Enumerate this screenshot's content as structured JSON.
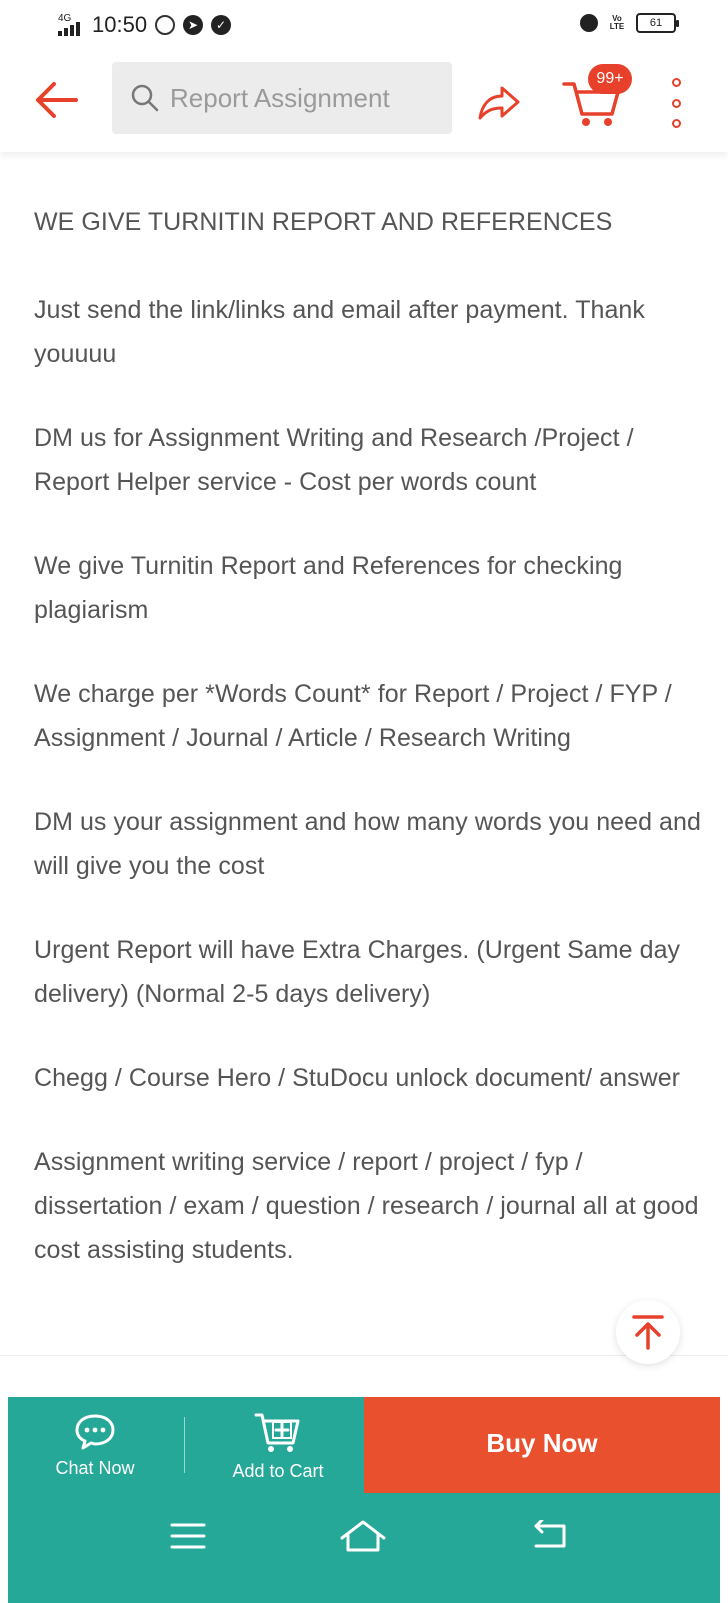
{
  "status_bar": {
    "time": "10:50",
    "network": "4G",
    "volte": "Vo LTE",
    "battery": "61"
  },
  "header": {
    "search_placeholder": "Report Assignment",
    "cart_count": "99+"
  },
  "description": {
    "paragraphs": [
      "WE GIVE TURNITIN REPORT AND REFERENCES",
      "Just send the link/links and email after payment. Thank youuuu",
      "DM us for Assignment Writing and Research /Project / Report Helper service - Cost per words count",
      "We give Turnitin Report and References for checking plagiarism",
      "We charge per *Words Count* for Report / Project / FYP / Assignment / Journal / Article / Research Writing",
      "DM us your assignment and how many words you need and will give you the cost",
      "Urgent Report will have Extra Charges. (Urgent Same day delivery) (Normal 2-5 days delivery)",
      "Chegg / Course Hero / StuDocu unlock document/ answer",
      "Assignment writing service / report / project / fyp / dissertation / exam / question / research / journal all at good cost assisting students."
    ]
  },
  "action_bar": {
    "chat_label": "Chat Now",
    "add_to_cart_label": "Add to Cart",
    "buy_label": "Buy Now"
  },
  "colors": {
    "accent": "#e8412b",
    "action_bar": "#26a899",
    "buy_button": "#e8502e"
  },
  "icons": [
    "back-arrow-icon",
    "search-icon",
    "share-icon",
    "cart-icon",
    "more-icon",
    "chat-icon",
    "add-to-cart-icon",
    "scroll-to-top-icon",
    "menu-icon",
    "home-icon",
    "back-icon"
  ]
}
